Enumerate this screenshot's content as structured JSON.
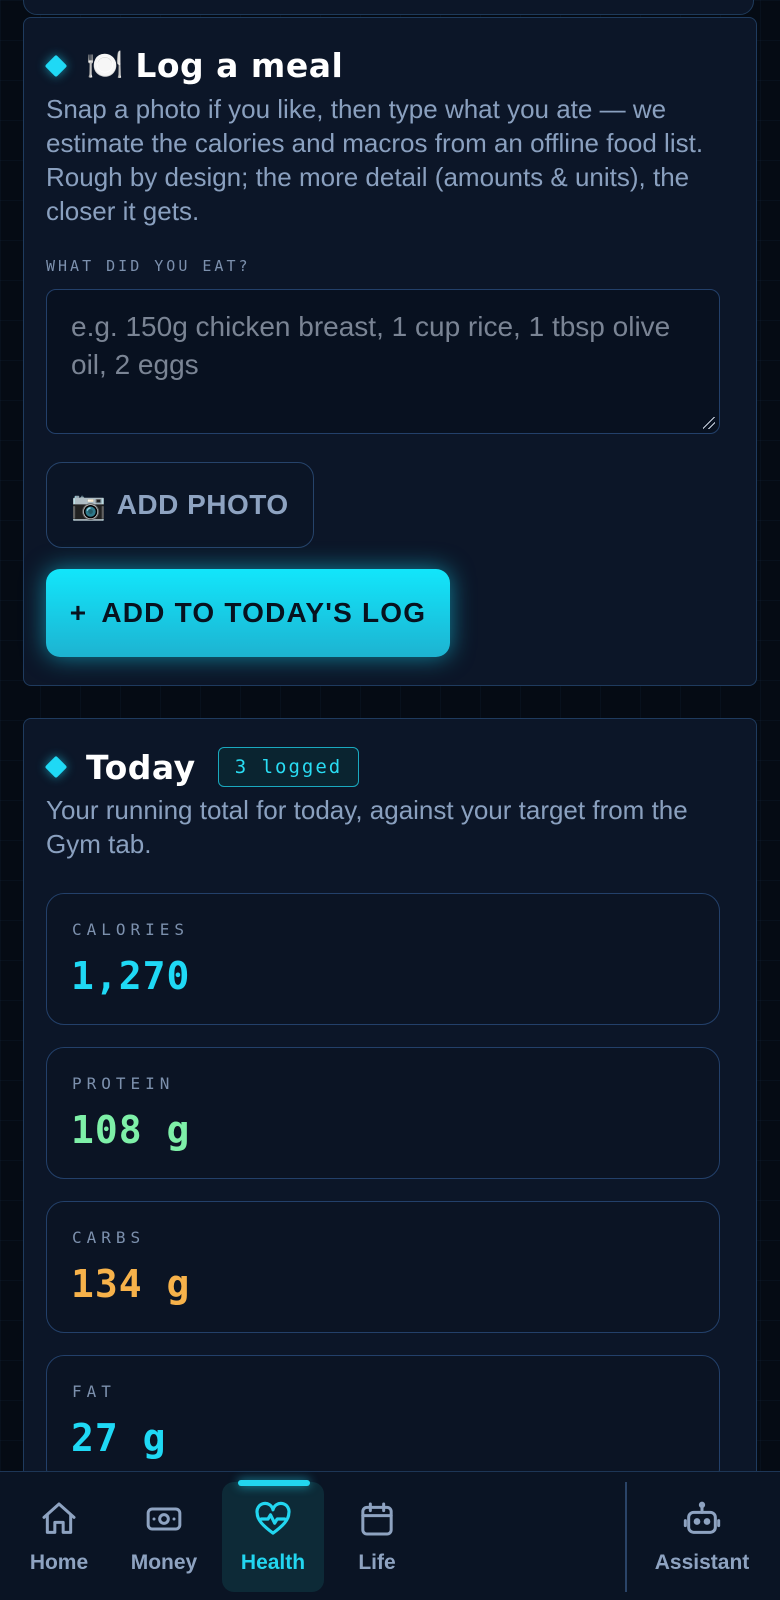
{
  "colors": {
    "accent": "#1fd9f5",
    "protein": "#7ef0a8",
    "carbs": "#f7b24a",
    "fat": "#1fd9f5",
    "calories": "#1fd9f5"
  },
  "meal_card": {
    "title_icon": "🍽️",
    "title": "Log a meal",
    "description": "Snap a photo if you like, then type what you ate — we estimate the calories and macros from an offline food list. Rough by design; the more detail (amounts & units), the closer it gets.",
    "field_label": "WHAT DID YOU EAT?",
    "field_placeholder": "e.g. 150g chicken breast, 1 cup rice, 1 tbsp olive oil, 2 eggs",
    "field_value": "",
    "photo_button_icon": "📷",
    "photo_button_label": "ADD PHOTO",
    "add_button_icon": "+",
    "add_button_label": "ADD TO TODAY'S LOG"
  },
  "today_card": {
    "title": "Today",
    "badge": "3 logged",
    "description": "Your running total for today, against your target from the Gym tab.",
    "stats": [
      {
        "label": "CALORIES",
        "value": "1,270"
      },
      {
        "label": "PROTEIN",
        "value": "108 g"
      },
      {
        "label": "CARBS",
        "value": "134 g"
      },
      {
        "label": "FAT",
        "value": "27 g"
      }
    ]
  },
  "nav": {
    "items": [
      {
        "label": "Home",
        "icon": "home-icon"
      },
      {
        "label": "Money",
        "icon": "money-icon"
      },
      {
        "label": "Health",
        "icon": "heart-pulse-icon",
        "active": true
      },
      {
        "label": "Life",
        "icon": "calendar-icon"
      },
      {
        "label": "Assistant",
        "icon": "robot-icon"
      }
    ]
  }
}
